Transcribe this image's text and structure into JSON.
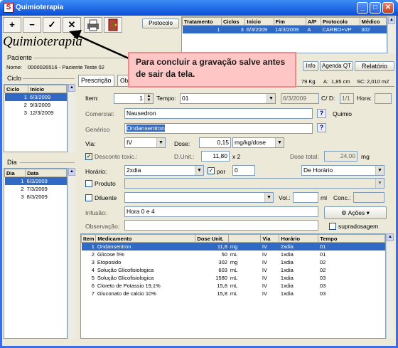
{
  "window": {
    "title": "Quimioterapia",
    "minimize": "_",
    "maximize": "□",
    "close": "✕"
  },
  "toolbar": {
    "add": "+",
    "remove": "−",
    "confirm": "✓",
    "cancel": "✕"
  },
  "app_title": "Quimioterapia",
  "protocol_button": "Protocolo",
  "treatment_table": {
    "headers": [
      "Tratamento",
      "Ciclos",
      "Início",
      "Fim",
      "A/P",
      "Protocolo",
      "Médico"
    ],
    "rows": [
      [
        "1",
        "3",
        "6/3/2009",
        "14/3/2009",
        "A",
        "CARBO+VP",
        "302"
      ]
    ]
  },
  "patient": {
    "group_label": "Paciente",
    "name_label": "Nome:",
    "name_value": "0000026516 - Paciente Teste 02"
  },
  "callout": "Para concluir a gravação salve antes de sair da tela.",
  "buttons": {
    "info": "Info",
    "agenda": "Agenda QT",
    "report": "Relatório"
  },
  "vitals": {
    "weight": "79 Kg",
    "height_label": "A:",
    "height": "1,85 cm",
    "sc_label": "SC:",
    "sc": "2,010 m2"
  },
  "cycle": {
    "group_label": "Ciclo",
    "headers": [
      "Ciclo",
      "Início"
    ],
    "rows": [
      [
        "1",
        "6/3/2009"
      ],
      [
        "2",
        "9/3/2009"
      ],
      [
        "3",
        "12/3/2009"
      ]
    ]
  },
  "day": {
    "group_label": "Dia",
    "headers": [
      "Dia",
      "Data"
    ],
    "rows": [
      [
        "1",
        "6/3/2009"
      ],
      [
        "2",
        "7/3/2009"
      ],
      [
        "3",
        "8/3/2009"
      ]
    ]
  },
  "tabs": [
    "Prescrição",
    "Obs"
  ],
  "form": {
    "item_label": "Item:",
    "item_value": "1",
    "tempo_label": "Tempo:",
    "tempo_value": "01",
    "date_value": "6/3/2009",
    "cd_label": "C/ D:",
    "cd_value": "1/1",
    "hora_label": "Hora:",
    "comercial_label": "Comercial:",
    "comercial_value": "Nausedron",
    "generico_label": "Genérico",
    "generico_value": "Ondansentron",
    "quimio_label": "Quimio",
    "help": "?",
    "via_label": "Via:",
    "via_value": "IV",
    "dose_label": "Dose:",
    "dose_value": "0,15",
    "dose_unit": "mg/kg/dose",
    "desconto_label": "Desconto toxic.:",
    "dunit_label": "D.Unit.:",
    "dunit_value": "11,80",
    "dunit_mult": "x 2",
    "dose_total_label": "Dose total:",
    "dose_total_value": "24,00",
    "dose_total_unit": "mg",
    "horario_label": "Horário:",
    "horario_value": "2xdia",
    "por_label": "por",
    "por_value": "0",
    "de_horario": "De Horário",
    "produto_label": "Produto",
    "diluente_label": "Diluente",
    "vol_label": "Vol.:",
    "vol_unit": "ml",
    "conc_label": "Conc.:",
    "infusao_label": "Infusão:",
    "infusao_value": "Hora 0 e 4",
    "acoes_label": "Ações",
    "observacao_label": "Observação:",
    "supradosagem_label": "supradosagem"
  },
  "meds": {
    "headers": [
      "Item",
      "Medicamento",
      "Dose Unit.",
      "",
      "Via",
      "Horário",
      "Tempo"
    ],
    "rows": [
      [
        "1",
        "Ondansentron",
        "11,8",
        "mg",
        "IV",
        "2xdia",
        "01"
      ],
      [
        "2",
        "Glicose 5%",
        "50",
        "mL",
        "IV",
        "1xdia",
        "01"
      ],
      [
        "3",
        "Etoposido",
        "302",
        "mg",
        "IV",
        "1xdia",
        "02"
      ],
      [
        "4",
        "Solução Glicofisiologica",
        "603",
        "mL",
        "IV",
        "1xdia",
        "02"
      ],
      [
        "5",
        "Solução Glicofisiologica",
        "1580",
        "mL",
        "IV",
        "1xdia",
        "03"
      ],
      [
        "6",
        "Cloreto de Potassio 19,1%",
        "15,8",
        "mL",
        "IV",
        "1xdia",
        "03"
      ],
      [
        "7",
        "Gluconato de calcio 10%",
        "15,8",
        "mL",
        "IV",
        "1xdia",
        "03"
      ]
    ]
  }
}
